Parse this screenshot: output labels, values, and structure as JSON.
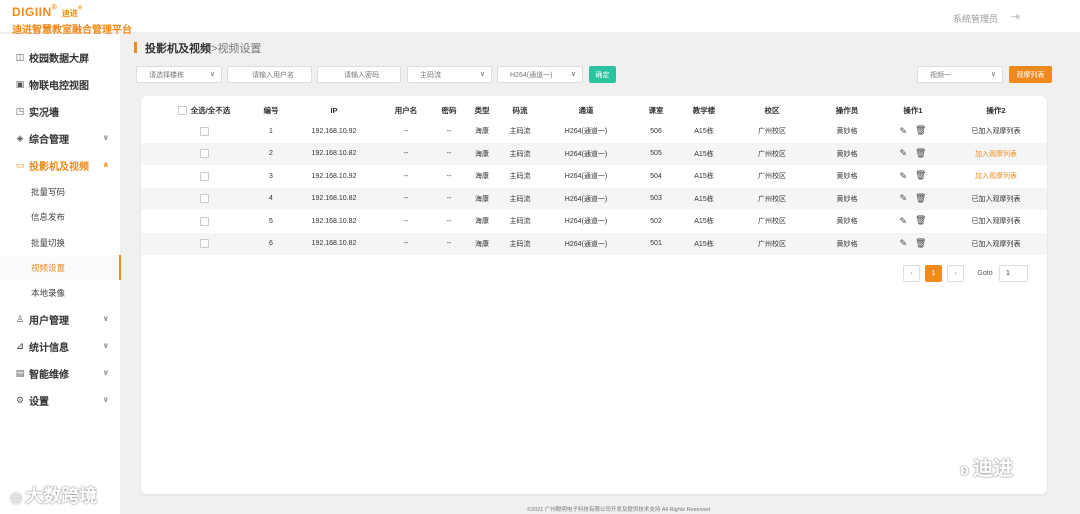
{
  "header": {
    "brand_en": "DIGIIN",
    "brand_cn_small": "迪进",
    "brand_sub": "迪进智慧教室融合管理平台",
    "admin": "系统管理员",
    "logout_icon": "logout-icon"
  },
  "sidebar": {
    "items": [
      {
        "label": "校园数据大屏",
        "icon": "screen-icon",
        "glyph": "◫"
      },
      {
        "label": "物联电控视图",
        "icon": "monitor-icon",
        "glyph": "▣"
      },
      {
        "label": "实况墙",
        "icon": "wall-icon",
        "glyph": "◳"
      },
      {
        "label": "综合管理",
        "icon": "layers-icon",
        "glyph": "◈",
        "chevron": "∨"
      },
      {
        "label": "投影机及视频",
        "icon": "projector-icon",
        "glyph": "▭",
        "chevron": "∧",
        "active": true
      },
      {
        "label": "用户管理",
        "icon": "user-icon",
        "glyph": "♙",
        "chevron": "∨"
      },
      {
        "label": "统计信息",
        "icon": "chart-icon",
        "glyph": "⊿",
        "chevron": "∨"
      },
      {
        "label": "智能维修",
        "icon": "repair-icon",
        "glyph": "▤",
        "chevron": "∨"
      },
      {
        "label": "设置",
        "icon": "settings-icon",
        "glyph": "⚙",
        "chevron": "∨"
      }
    ],
    "sub_items": [
      {
        "label": "批量写码"
      },
      {
        "label": "信息发布"
      },
      {
        "label": "批量切换"
      },
      {
        "label": "视频设置",
        "active": true
      },
      {
        "label": "本地录像"
      }
    ]
  },
  "breadcrumb": {
    "parent": "投影机及视频",
    "separator": ">",
    "current": "视频设置"
  },
  "filters": {
    "building": "请选择楼栋",
    "username": "请输入用户名",
    "password": "请输入密码",
    "stream": "主码流",
    "channel": "H264(通道一)",
    "confirm": "确定",
    "view": "视频一",
    "view_list": "观摩列表"
  },
  "table": {
    "headers": [
      "全选/全不选",
      "编号",
      "IP",
      "用户名",
      "密码",
      "类型",
      "码流",
      "通道",
      "课室",
      "教学楼",
      "校区",
      "操作员",
      "操作1",
      "操作2"
    ],
    "rows": [
      {
        "no": "1",
        "ip": "192.168.10.92",
        "user": "--",
        "pwd": "--",
        "type": "海康",
        "stream": "主码流",
        "channel": "H264(通道一)",
        "room": "506",
        "building": "A15栋",
        "campus": "广州校区",
        "operator": "黄妙格",
        "op2": "已加入观摩列表",
        "op2_orange": false
      },
      {
        "no": "2",
        "ip": "192.168.10.82",
        "user": "--",
        "pwd": "--",
        "type": "海康",
        "stream": "主码流",
        "channel": "H264(通道一)",
        "room": "505",
        "building": "A15栋",
        "campus": "广州校区",
        "operator": "黄妙格",
        "op2": "加入观摩列表",
        "op2_orange": true
      },
      {
        "no": "3",
        "ip": "192.168.10.92",
        "user": "--",
        "pwd": "--",
        "type": "海康",
        "stream": "主码流",
        "channel": "H264(通道一)",
        "room": "504",
        "building": "A15栋",
        "campus": "广州校区",
        "operator": "黄妙格",
        "op2": "加入观摩列表",
        "op2_orange": true
      },
      {
        "no": "4",
        "ip": "192.168.10.82",
        "user": "--",
        "pwd": "--",
        "type": "海康",
        "stream": "主码流",
        "channel": "H264(通道一)",
        "room": "503",
        "building": "A15栋",
        "campus": "广州校区",
        "operator": "黄妙格",
        "op2": "已加入观摩列表",
        "op2_orange": false
      },
      {
        "no": "5",
        "ip": "192.168.10.82",
        "user": "--",
        "pwd": "--",
        "type": "海康",
        "stream": "主码流",
        "channel": "H264(通道一)",
        "room": "502",
        "building": "A15栋",
        "campus": "广州校区",
        "operator": "黄妙格",
        "op2": "已加入观摩列表",
        "op2_orange": false
      },
      {
        "no": "6",
        "ip": "192.168.10.82",
        "user": "--",
        "pwd": "--",
        "type": "海康",
        "stream": "主码流",
        "channel": "H264(通道一)",
        "room": "501",
        "building": "A15栋",
        "campus": "广州校区",
        "operator": "黄妙格",
        "op2": "已加入观摩列表",
        "op2_orange": false
      }
    ]
  },
  "pagination": {
    "prev": "‹",
    "page": "1",
    "next": "›",
    "goto_label": "Goto",
    "goto_value": "1"
  },
  "footer": "©2021 广州聪明电子科技有限公司开发及提供技术支持 All Rights Reserved",
  "watermarks": {
    "right": "迪进",
    "left": "大数跨境"
  },
  "colors": {
    "accent": "#f08a1c",
    "confirm": "#2cc3a0"
  }
}
